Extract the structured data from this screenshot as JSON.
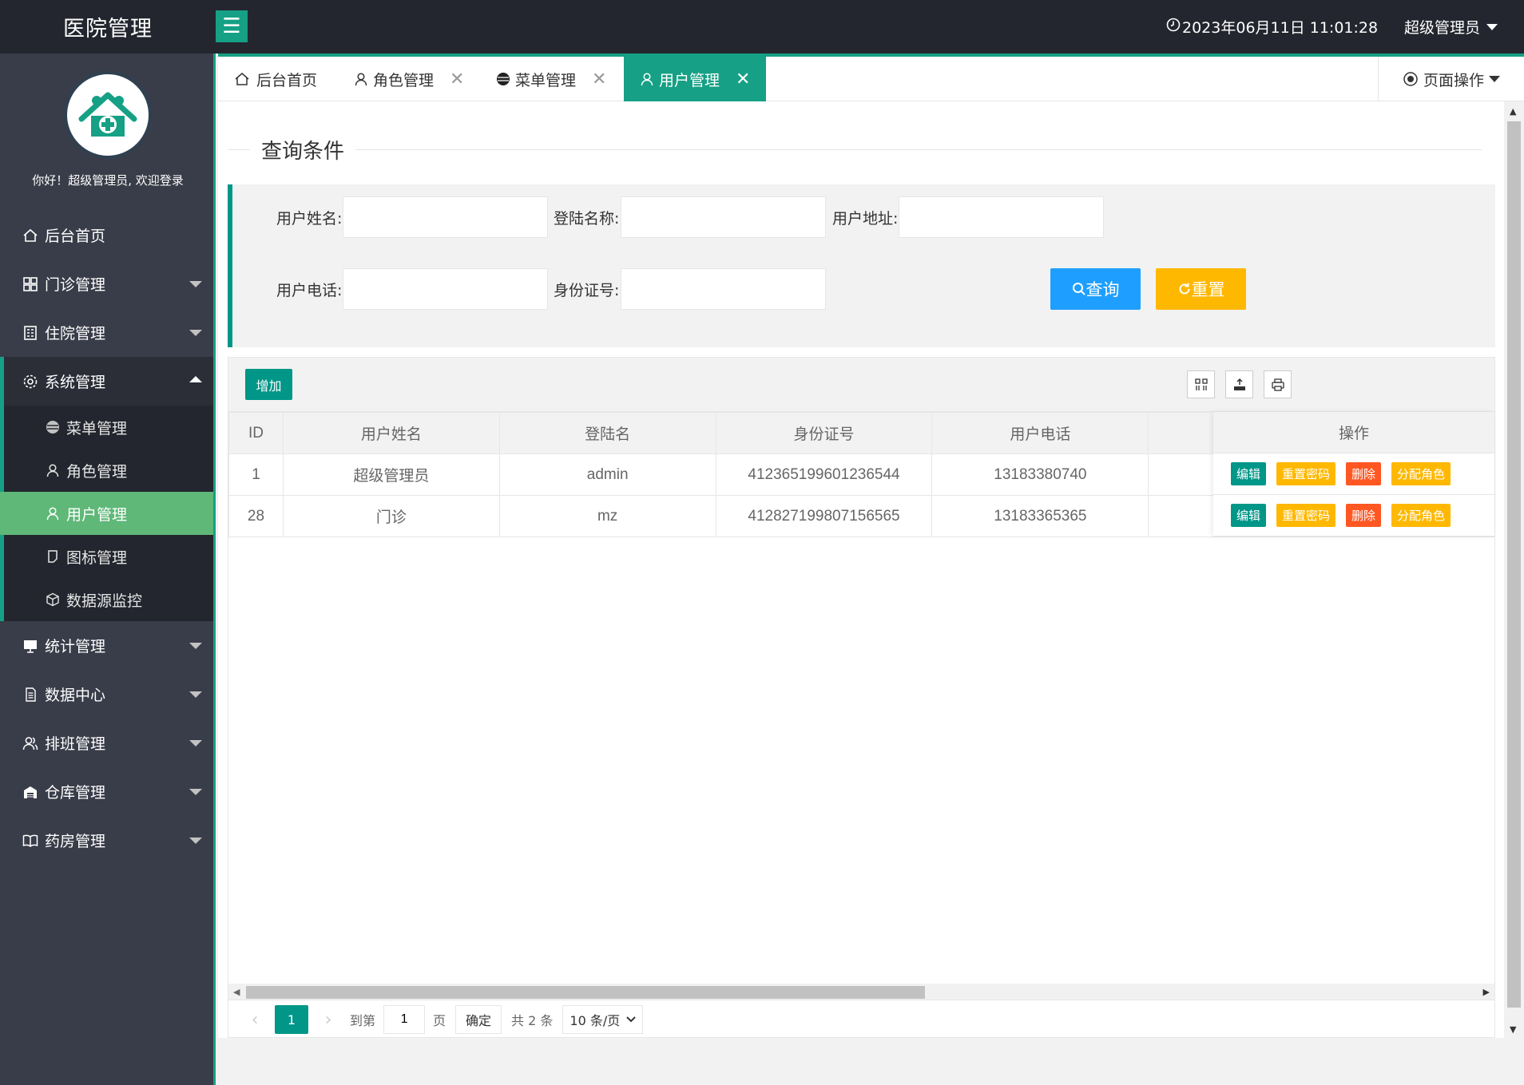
{
  "header": {
    "logo": "医院管理",
    "menu_toggle": "☰",
    "clock": "2023年06月11日 11:01:28",
    "user": "超级管理员"
  },
  "sidebar": {
    "welcome": "你好！超级管理员, 欢迎登录",
    "items": [
      {
        "label": "后台首页",
        "icon": "home-icon"
      },
      {
        "label": "门诊管理",
        "icon": "grid-icon"
      },
      {
        "label": "住院管理",
        "icon": "building-icon"
      },
      {
        "label": "系统管理",
        "icon": "gear-icon"
      },
      {
        "label": "统计管理",
        "icon": "monitor-icon"
      },
      {
        "label": "数据中心",
        "icon": "document-icon"
      },
      {
        "label": "排班管理",
        "icon": "users-icon"
      },
      {
        "label": "仓库管理",
        "icon": "warehouse-icon"
      },
      {
        "label": "药房管理",
        "icon": "book-icon"
      }
    ],
    "sub_items": [
      {
        "label": "菜单管理",
        "icon": "circle-icon"
      },
      {
        "label": "角色管理",
        "icon": "user-icon"
      },
      {
        "label": "用户管理",
        "icon": "user-icon"
      },
      {
        "label": "图标管理",
        "icon": "file-icon"
      },
      {
        "label": "数据源监控",
        "icon": "cube-icon"
      }
    ]
  },
  "tabs": [
    {
      "label": "后台首页"
    },
    {
      "label": "角色管理"
    },
    {
      "label": "菜单管理"
    },
    {
      "label": "用户管理"
    }
  ],
  "tab_close": "✕",
  "page_ops": "页面操作",
  "search": {
    "title": "查询条件",
    "fields": [
      {
        "label": "用户姓名:",
        "value": ""
      },
      {
        "label": "登陆名称:",
        "value": ""
      },
      {
        "label": "用户地址:",
        "value": ""
      },
      {
        "label": "用户电话:",
        "value": ""
      },
      {
        "label": "身份证号:",
        "value": ""
      }
    ],
    "query_btn": "查询",
    "reset_btn": "重置"
  },
  "toolbar": {
    "add_btn": "增加"
  },
  "table": {
    "columns": [
      "ID",
      "用户姓名",
      "登陆名",
      "身份证号",
      "用户电话",
      ""
    ],
    "ops_header": "操作",
    "rows": [
      {
        "id": "1",
        "name": "超级管理员",
        "login": "admin",
        "idcard": "412365199601236544",
        "phone": "13183380740"
      },
      {
        "id": "28",
        "name": "门诊",
        "login": "mz",
        "idcard": "412827199807156565",
        "phone": "13183365365"
      }
    ],
    "row_actions": [
      "编辑",
      "重置密码",
      "删除",
      "分配角色"
    ]
  },
  "pager": {
    "current": "1",
    "goto_label": "到第",
    "goto_value": "1",
    "page_label": "页",
    "confirm": "确定",
    "total": "共 2 条",
    "page_size": "10 条/页"
  },
  "colors": {
    "accent": "#16a085",
    "sidebar_bg": "#393d49",
    "active_sub": "#5fb878",
    "blue": "#1e9fff",
    "yellow": "#ffb800",
    "red": "#ff5722"
  }
}
